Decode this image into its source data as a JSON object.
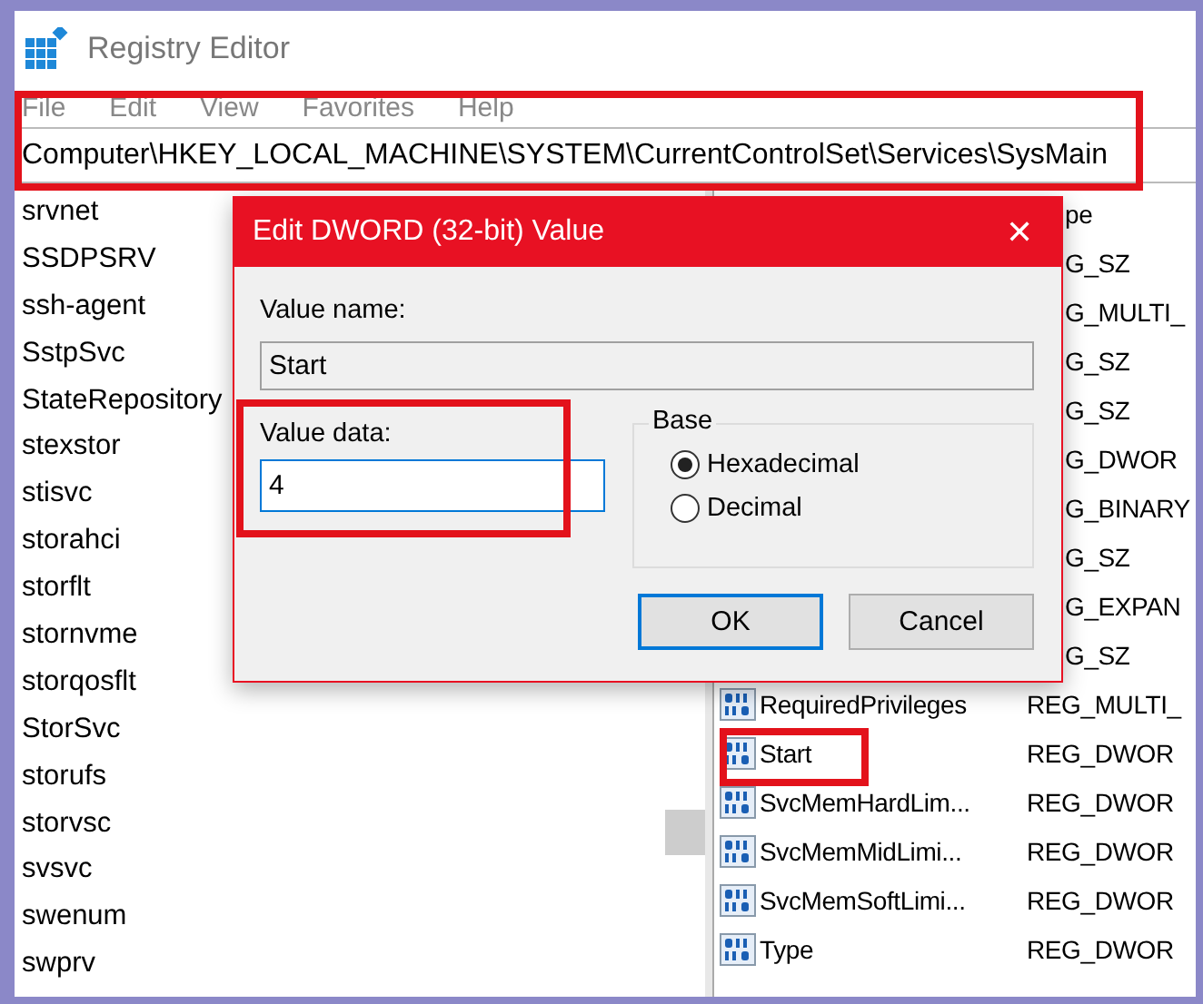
{
  "window": {
    "title": "Registry Editor"
  },
  "menu": [
    "File",
    "Edit",
    "View",
    "Favorites",
    "Help"
  ],
  "address": "Computer\\HKEY_LOCAL_MACHINE\\SYSTEM\\CurrentControlSet\\Services\\SysMain",
  "tree": {
    "items": [
      "srvnet",
      "SSDPSRV",
      "ssh-agent",
      "SstpSvc",
      "StateRepository",
      "stexstor",
      "stisvc",
      "storahci",
      "storflt",
      "stornvme",
      "storqosflt",
      "StorSvc",
      "storufs",
      "storvsc",
      "svsvc",
      "swenum",
      "swprv"
    ]
  },
  "values": {
    "rows": [
      {
        "kind": "header",
        "type": "pe"
      },
      {
        "kind": "covered",
        "type": "G_SZ"
      },
      {
        "kind": "covered",
        "type": "G_MULTI_"
      },
      {
        "kind": "covered",
        "type": "G_SZ"
      },
      {
        "kind": "covered",
        "type": "G_SZ"
      },
      {
        "kind": "covered",
        "type": "G_DWOR"
      },
      {
        "kind": "covered",
        "type": "G_BINARY"
      },
      {
        "kind": "covered",
        "type": "G_SZ"
      },
      {
        "kind": "covered",
        "type": "G_EXPAN"
      },
      {
        "kind": "covered",
        "type": "G_SZ"
      },
      {
        "kind": "value",
        "name": "RequiredPrivileges",
        "type": "REG_MULTI_"
      },
      {
        "kind": "value",
        "name": "Start",
        "type": "REG_DWOR"
      },
      {
        "kind": "value",
        "name": "SvcMemHardLim...",
        "type": "REG_DWOR"
      },
      {
        "kind": "value",
        "name": "SvcMemMidLimi...",
        "type": "REG_DWOR"
      },
      {
        "kind": "value",
        "name": "SvcMemSoftLimi...",
        "type": "REG_DWOR"
      },
      {
        "kind": "value",
        "name": "Type",
        "type": "REG_DWOR"
      }
    ]
  },
  "dialog": {
    "title": "Edit DWORD (32-bit) Value",
    "close": "✕",
    "value_name_label": "Value name:",
    "value_name": "Start",
    "value_data_label": "Value data:",
    "value_data": "4",
    "base_label": "Base",
    "radios": [
      {
        "label": "Hexadecimal",
        "selected": true
      },
      {
        "label": "Decimal",
        "selected": false
      }
    ],
    "buttons": [
      {
        "label": "OK",
        "default": true
      },
      {
        "label": "Cancel",
        "default": false
      }
    ]
  },
  "annotations": [
    {
      "kind": "highlight"
    },
    {
      "kind": "highlight"
    },
    {
      "kind": "highlight"
    }
  ]
}
